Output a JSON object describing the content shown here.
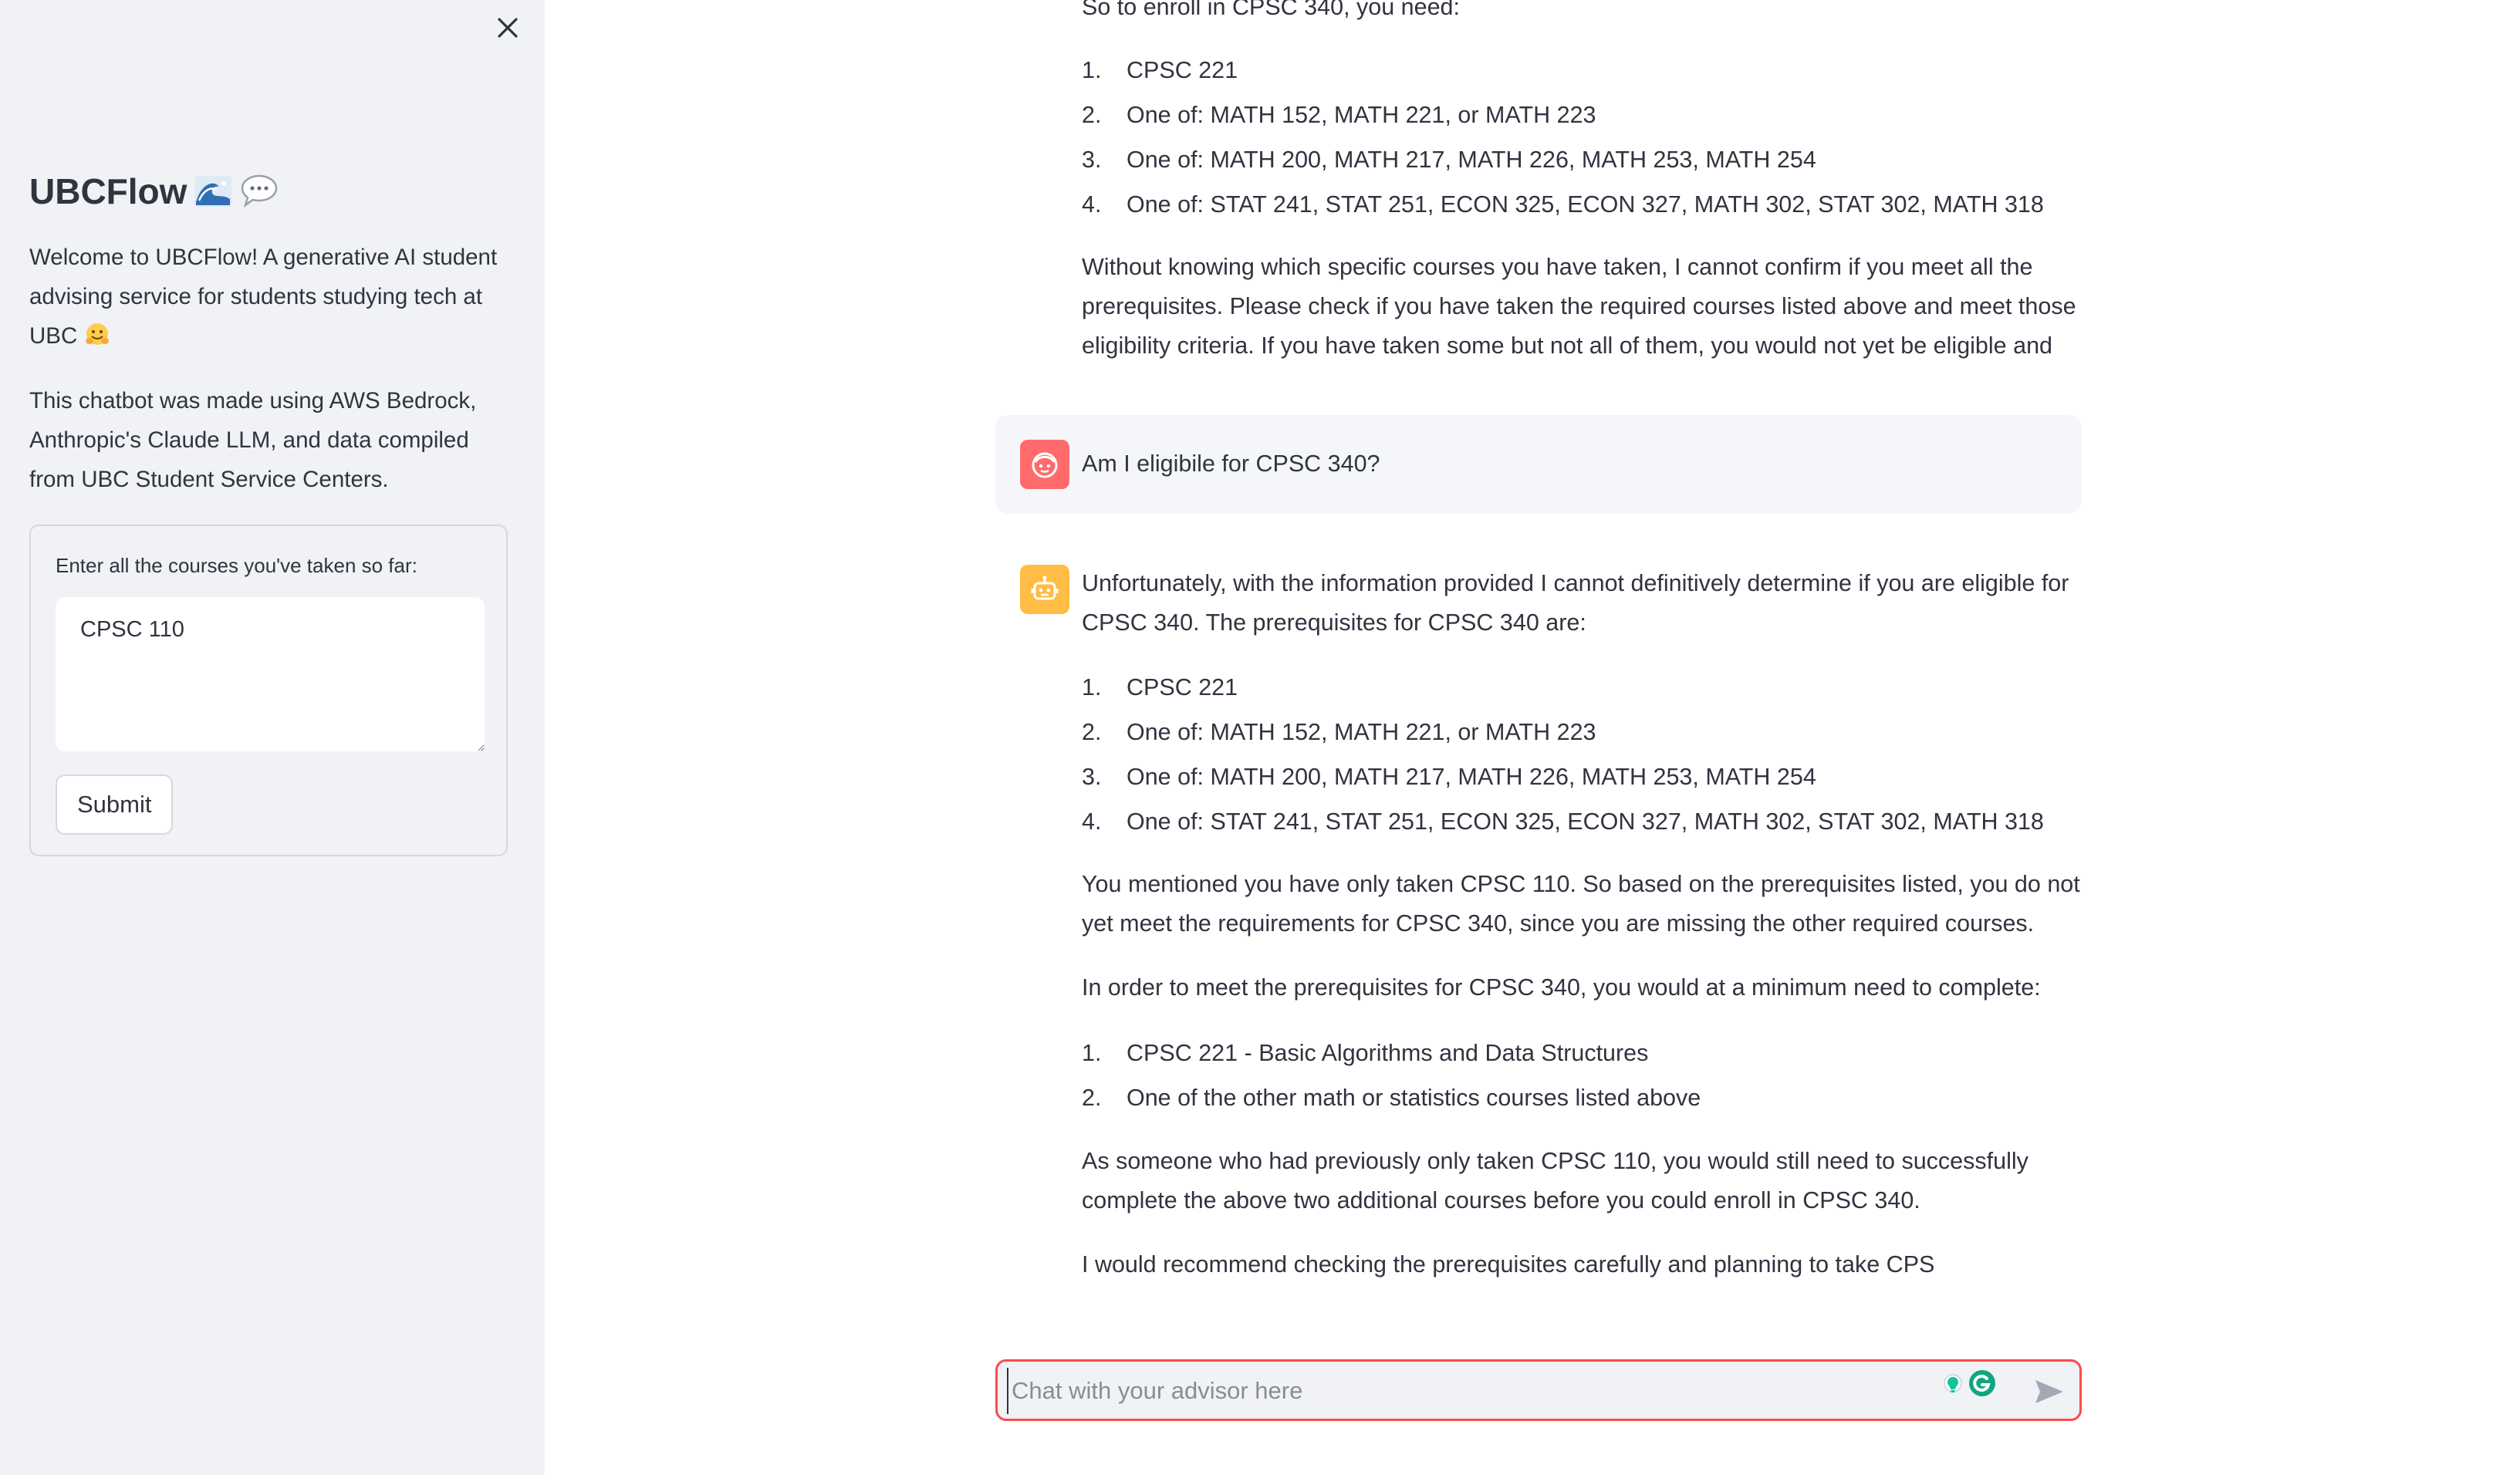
{
  "sidebar": {
    "close_label": "×",
    "title": "UBCFlow",
    "intro": "Welcome to UBCFlow! A generative AI student advising service for students studying tech at UBC",
    "tech_note": "This chatbot was made using AWS Bedrock, Anthropic's Claude LLM, and data compiled from UBC Student Service Centers.",
    "form": {
      "label": "Enter all the courses you've taken so far:",
      "courses_value": "CPSC 110",
      "submit_label": "Submit"
    }
  },
  "chat": {
    "prev_assistant": {
      "intro": "So to enroll in CPSC 340, you need:",
      "list": [
        {
          "num": "1.",
          "text": "CPSC 221"
        },
        {
          "num": "2.",
          "text": "One of: MATH 152, MATH 221, or MATH 223"
        },
        {
          "num": "3.",
          "text": "One of: MATH 200, MATH 217, MATH 226, MATH 253, MATH 254"
        },
        {
          "num": "4.",
          "text": "One of: STAT 241, STAT 251, ECON 325, ECON 327, MATH 302, STAT 302, MATH 318"
        }
      ],
      "closing": "Without knowing which specific courses you have taken, I cannot confirm if you meet all the prerequisites. Please check if you have taken the required courses listed above and meet those eligibility criteria. If you have taken some but not all of them, you would not yet be eligible and"
    },
    "user_message": "Am I eligibile for CPSC 340?",
    "assistant": {
      "p1": "Unfortunately, with the information provided I cannot definitively determine if you are eligible for CPSC 340. The prerequisites for CPSC 340 are:",
      "list1": [
        {
          "num": "1.",
          "text": "CPSC 221"
        },
        {
          "num": "2.",
          "text": "One of: MATH 152, MATH 221, or MATH 223"
        },
        {
          "num": "3.",
          "text": "One of: MATH 200, MATH 217, MATH 226, MATH 253, MATH 254"
        },
        {
          "num": "4.",
          "text": "One of: STAT 241, STAT 251, ECON 325, ECON 327, MATH 302, STAT 302, MATH 318"
        }
      ],
      "p2": "You mentioned you have only taken CPSC 110. So based on the prerequisites listed, you do not yet meet the requirements for CPSC 340, since you are missing the other required courses.",
      "p3": "In order to meet the prerequisites for CPSC 340, you would at a minimum need to complete:",
      "list2": [
        {
          "num": "1.",
          "text": "CPSC 221 - Basic Algorithms and Data Structures"
        },
        {
          "num": "2.",
          "text": "One of the other math or statistics courses listed above"
        }
      ],
      "p4": "As someone who had previously only taken CPSC 110, you would still need to successfully complete the above two additional courses before you could enroll in CPSC 340.",
      "p5": "I would recommend checking the prerequisites carefully and planning to take CPS"
    },
    "input_placeholder": "Chat with your advisor here"
  },
  "colors": {
    "sidebar_bg": "#f0f2f6",
    "accent_red": "#ff4b4b",
    "user_avatar": "#ff6b6b",
    "bot_avatar": "#ffbd45",
    "text": "#31333f"
  }
}
